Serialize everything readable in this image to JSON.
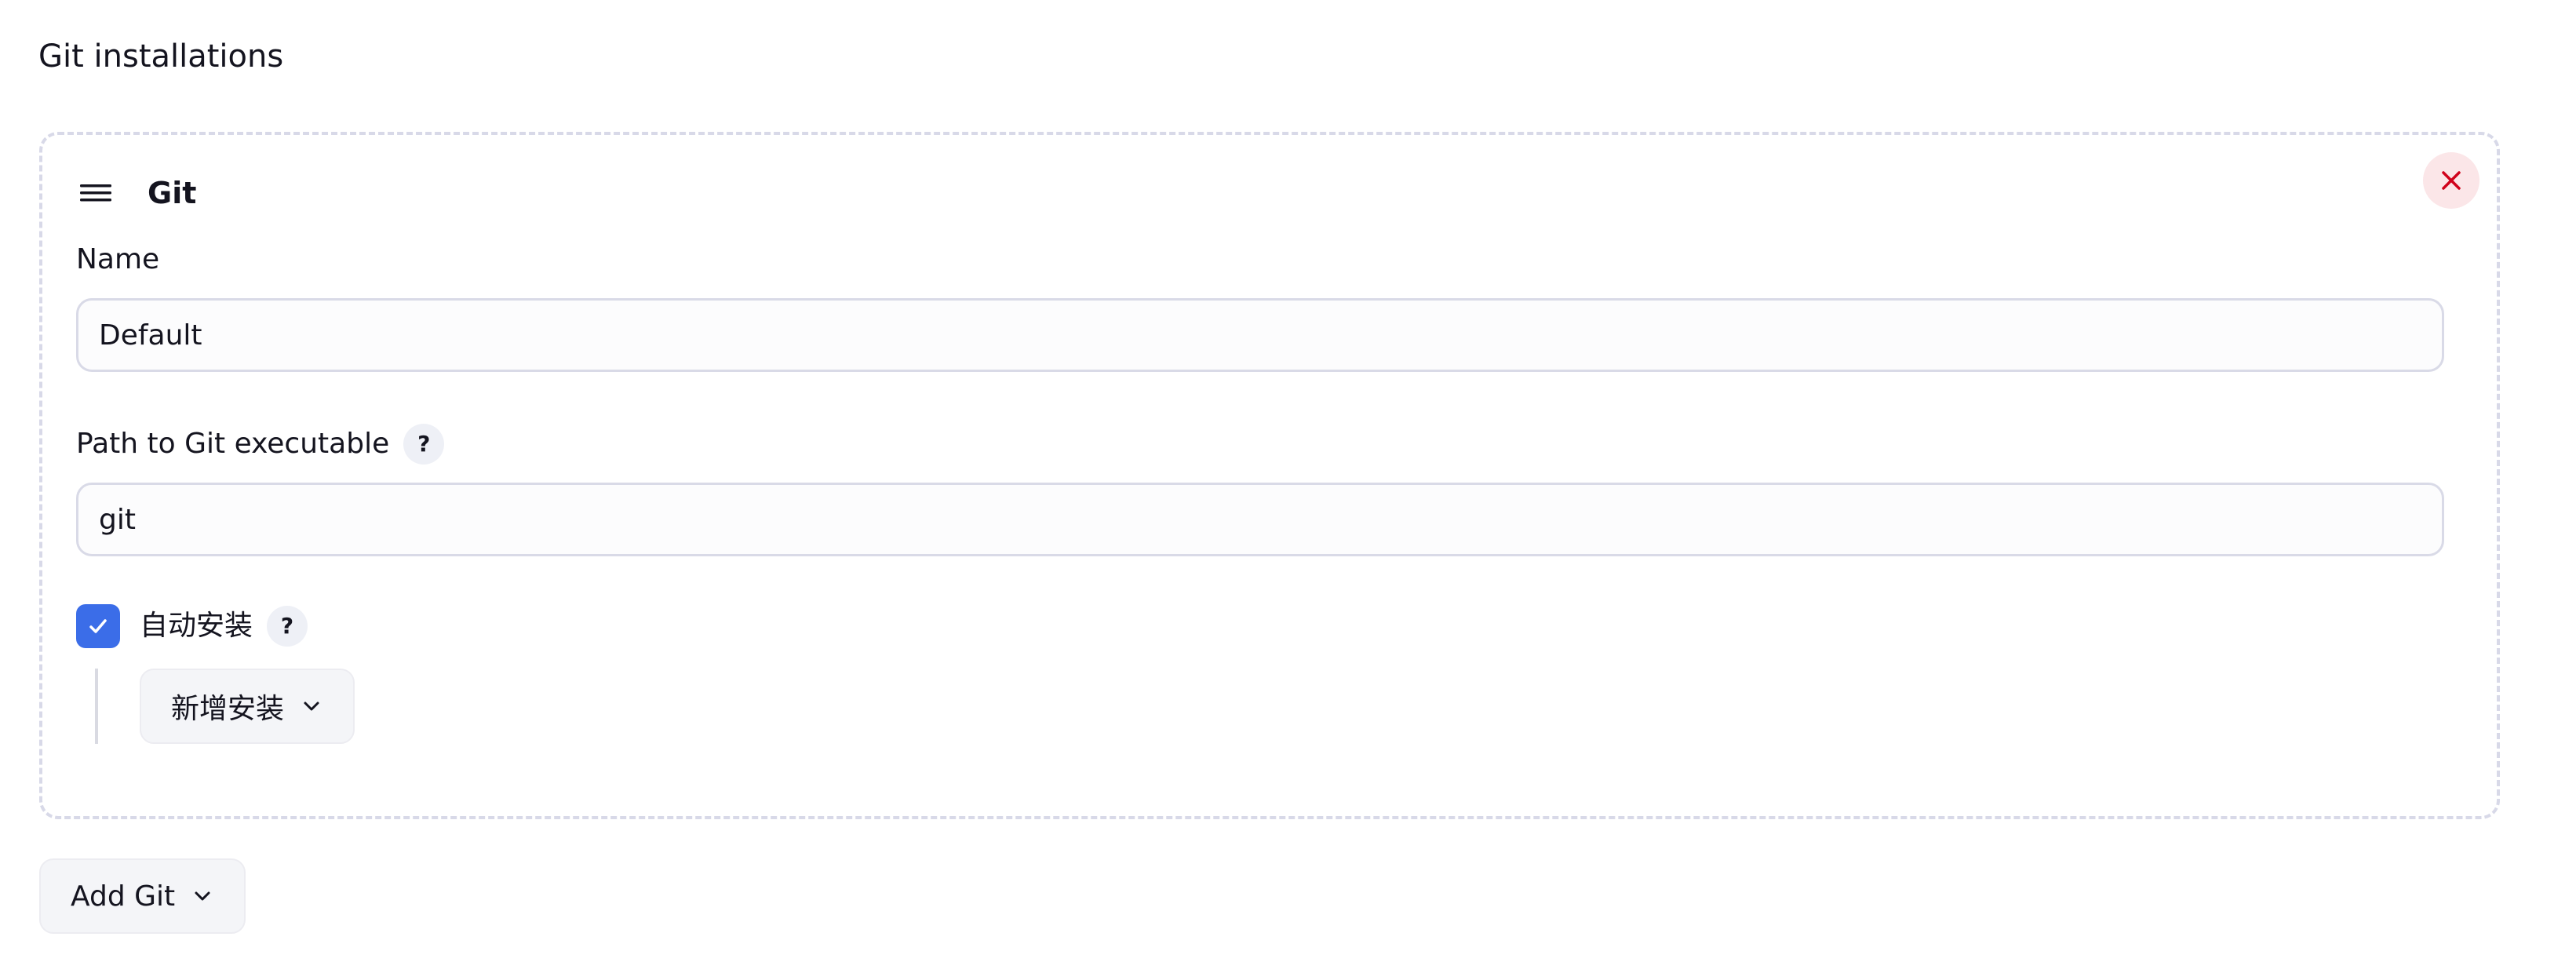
{
  "section": {
    "title": "Git installations"
  },
  "card": {
    "title": "Git",
    "drag_handle_icon": "menu-lines-icon",
    "close_icon": "close-x-icon",
    "close_color": "#d0021b"
  },
  "fields": {
    "name": {
      "label": "Name",
      "value": "Default"
    },
    "path": {
      "label": "Path to Git executable",
      "help": "?",
      "value": "git"
    }
  },
  "auto_install": {
    "checked": true,
    "label": "自动安装",
    "help": "?",
    "add_installer_label": "新增安装",
    "accent": "#3b6de8"
  },
  "footer": {
    "add_git_label": "Add Git"
  }
}
